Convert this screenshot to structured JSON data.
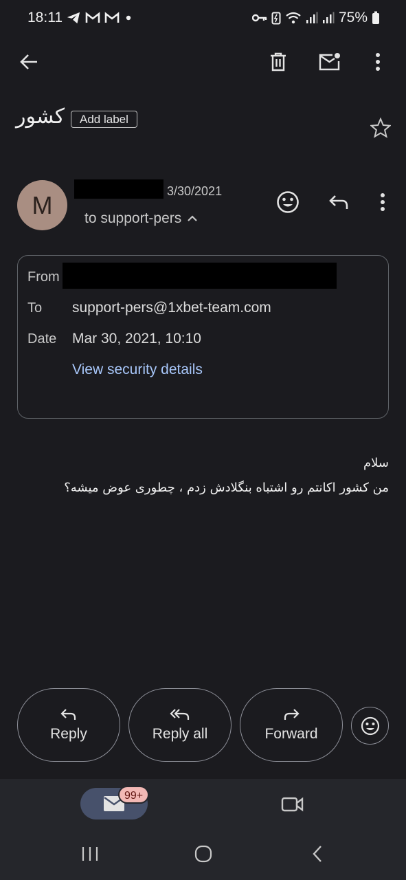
{
  "status_bar": {
    "time": "18:11",
    "battery": "75%"
  },
  "email": {
    "subject": "کشور",
    "add_label": "Add label",
    "sender_initial": "M",
    "date_short": "3/30/2021",
    "to_summary": "to support-pers",
    "details": {
      "from_label": "From",
      "to_label": "To",
      "to_value": "support-pers@1xbet-team.com",
      "date_label": "Date",
      "date_value": "Mar 30, 2021, 10:10",
      "security_link": "View security details"
    },
    "body": {
      "line1": "سلام",
      "line2": "من کشور اکانتم رو اشتباه بنگلادش زدم ، چطوری عوض میشه؟"
    }
  },
  "actions": {
    "reply": "Reply",
    "reply_all": "Reply all",
    "forward": "Forward"
  },
  "bottom_nav": {
    "mail_badge": "99+"
  },
  "colors": {
    "background": "#1b1b1f",
    "link": "#a8c7fa",
    "avatar": "#a98e82",
    "badge": "#f2b8b5"
  }
}
